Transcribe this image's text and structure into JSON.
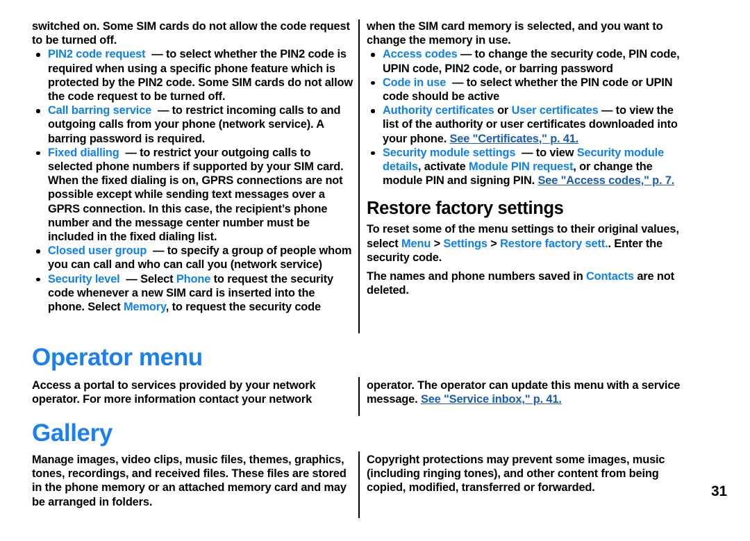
{
  "page": {
    "number": "31",
    "accent_blue": "#0f80f0",
    "heading_blue": "#1a7ff0",
    "link_blue": "#1a5cb8"
  },
  "left_column_top": {
    "continued_paragraph": "switched on. Some SIM cards do not allow the code request to be turned off.",
    "bullets": [
      {
        "term": "PIN2 code request",
        "dash": "—",
        "text": "to select whether the PIN2 code is required when using a specific phone feature which is protected by the PIN2 code. Some SIM cards do not allow the code request to be turned off."
      },
      {
        "term": "Call barring service",
        "dash": "—",
        "text": "to restrict incoming calls to and outgoing calls from your phone (network service). A barring password is required."
      },
      {
        "term": "Fixed dialling",
        "dash": "—",
        "text": "to restrict your outgoing calls to selected phone numbers if supported by your SIM card. When the fixed dialing is on, GPRS connections are not possible except while sending text messages over a GPRS connection. In this case, the recipient’s phone number and the message center number must be included in the fixed dialing list."
      },
      {
        "term": "Closed user group",
        "dash": "—",
        "text": "to specify a group of people whom you can call and who can call you (network service)"
      },
      {
        "term": "Security level",
        "dash": "—",
        "text_before": "Select",
        "inline_term_1": "Phone",
        "text_middle": "to request the security code whenever a new SIM card is inserted into the phone. Select",
        "inline_term_2": "Memory",
        "text_after": ", to request the security code"
      }
    ]
  },
  "right_column_top": {
    "continued_paragraph": "when the SIM card memory is selected, and you want to change the memory in use.",
    "bullets": [
      {
        "term": "Access codes",
        "dash": "—",
        "text": "to change the security code, PIN code, UPIN code, PIN2 code, or barring password"
      },
      {
        "term": "Code in use",
        "dash": "—",
        "text": "to select whether the PIN code or UPIN code should be active"
      },
      {
        "term": "Authority certificates",
        "conjunction": "or",
        "term_2": "User certificates",
        "dash": "—",
        "text": "to view the list of the authority or user certificates downloaded into your phone.",
        "link": "See \"Certificates,\" p. 41."
      },
      {
        "term": "Security module settings",
        "dash": "—",
        "text_before": "to view",
        "inline_term_1": "Security module details",
        "text_middle": ", activate",
        "inline_term_2": "Module PIN request",
        "text_after": ", or change the module PIN and signing PIN.",
        "link": "See \"Access codes,\" p. 7."
      }
    ]
  },
  "restore_factory": {
    "heading": "Restore factory settings",
    "paragraph_1_before": "To reset some of the menu settings to their original values, select",
    "menu_1": "Menu",
    "sep_1": ">",
    "menu_2": "Settings",
    "sep_2": ">",
    "menu_3": "Restore factory sett.",
    "paragraph_1_after": ". Enter the security code.",
    "paragraph_2_before": "The names and phone numbers saved in",
    "contacts_term": "Contacts",
    "paragraph_2_after": "are not deleted."
  },
  "operator_menu": {
    "heading": "Operator menu",
    "left_text": "Access a portal to services provided by your network operator. For more information contact your network",
    "right_text": "operator. The operator can update this menu with a service message.",
    "right_link": "See \"Service inbox,\" p. 41."
  },
  "gallery": {
    "heading": "Gallery",
    "left_text": "Manage images, video clips, music files, themes, graphics, tones, recordings, and received files. These files are stored in the phone memory or an attached memory card and may be arranged in folders.",
    "right_text": "Copyright protections may prevent some images, music (including ringing tones), and other content from being copied, modified, transferred or forwarded."
  }
}
